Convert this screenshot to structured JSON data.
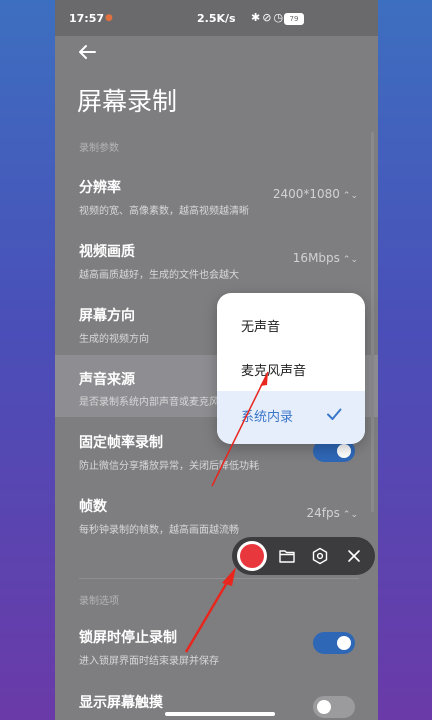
{
  "status_bar": {
    "time": "17:57",
    "network_speed": "2.5K/s",
    "battery_level": "79",
    "icons": [
      "bluetooth-icon",
      "mute-icon",
      "alarm-icon",
      "vibrate-icon",
      "wifi-icon",
      "battery-icon"
    ]
  },
  "header": {
    "title": "屏幕录制"
  },
  "sections": {
    "recording_params": "录制参数",
    "recording_options": "录制选项"
  },
  "settings": {
    "resolution": {
      "title": "分辨率",
      "desc": "视频的宽、高像素数，越高视频越清晰",
      "value": "2400*1080"
    },
    "quality": {
      "title": "视频画质",
      "desc": "越高画质越好，生成的文件也会越大",
      "value": "16Mbps"
    },
    "orientation": {
      "title": "屏幕方向",
      "desc": "生成的视频方向"
    },
    "sound_source": {
      "title": "声音来源",
      "desc": "是否录制系统内部声音或麦克风声音"
    },
    "fixed_fps": {
      "title": "固定帧率录制",
      "desc": "防止微信分享播放异常，关闭后降低功耗",
      "enabled": true
    },
    "fps": {
      "title": "帧数",
      "desc": "每秒钟录制的帧数，越高画面越流畅",
      "value": "24fps"
    },
    "lock_stop": {
      "title": "锁屏时停止录制",
      "desc": "进入锁屏界面时结束录屏并保存",
      "enabled": true
    },
    "show_touches": {
      "title": "显示屏幕触摸",
      "enabled": false
    }
  },
  "dropdown": {
    "options": [
      "无声音",
      "麦克风声音",
      "系统内录"
    ],
    "selected": "系统内录"
  },
  "record_toolbar": {
    "items": [
      "record-icon",
      "folder-icon",
      "settings-icon",
      "close-icon"
    ]
  },
  "colors": {
    "accent": "#3a76c9",
    "record_red": "#e8383d",
    "annotation_red": "#e8261e"
  }
}
